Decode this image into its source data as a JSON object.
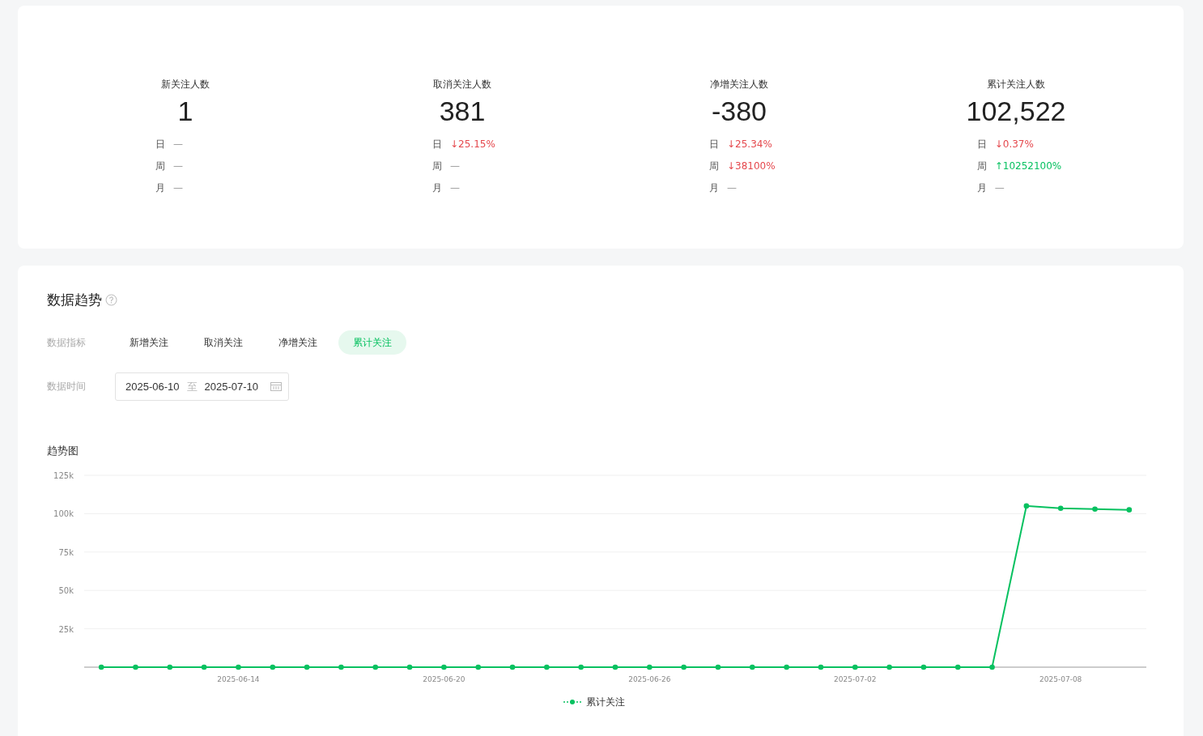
{
  "stats": [
    {
      "label": "新关注人数",
      "value": "1",
      "changes": [
        {
          "period": "日",
          "text": "—",
          "color": "#999999"
        },
        {
          "period": "周",
          "text": "—",
          "color": "#999999"
        },
        {
          "period": "月",
          "text": "—",
          "color": "#999999"
        }
      ]
    },
    {
      "label": "取消关注人数",
      "value": "381",
      "changes": [
        {
          "period": "日",
          "text": "↓25.15%",
          "color": "#e5484d"
        },
        {
          "period": "周",
          "text": "—",
          "color": "#999999"
        },
        {
          "period": "月",
          "text": "—",
          "color": "#999999"
        }
      ]
    },
    {
      "label": "净增关注人数",
      "value": "-380",
      "changes": [
        {
          "period": "日",
          "text": "↓25.34%",
          "color": "#e5484d"
        },
        {
          "period": "周",
          "text": "↓38100%",
          "color": "#e5484d"
        },
        {
          "period": "月",
          "text": "—",
          "color": "#999999"
        }
      ]
    },
    {
      "label": "累计关注人数",
      "value": "102,522",
      "changes": [
        {
          "period": "日",
          "text": "↓0.37%",
          "color": "#e5484d"
        },
        {
          "period": "周",
          "text": "↑10252100%",
          "color": "#07c160"
        },
        {
          "period": "月",
          "text": "—",
          "color": "#999999"
        }
      ]
    }
  ],
  "trend": {
    "title": "数据趋势",
    "metric_label": "数据指标",
    "metrics": [
      {
        "label": "新增关注",
        "selected": false
      },
      {
        "label": "取消关注",
        "selected": false
      },
      {
        "label": "净增关注",
        "selected": false
      },
      {
        "label": "累计关注",
        "selected": true
      }
    ],
    "date_label": "数据时间",
    "date_range": {
      "start": "2025-06-10",
      "separator": "至",
      "end": "2025-07-10"
    },
    "chart_title": "趋势图",
    "chart_data": {
      "type": "line",
      "categories": [
        null,
        null,
        null,
        null,
        "2025-06-14",
        null,
        null,
        null,
        null,
        null,
        "2025-06-20",
        null,
        null,
        null,
        null,
        null,
        "2025-06-26",
        null,
        null,
        null,
        null,
        null,
        "2025-07-02",
        null,
        null,
        null,
        null,
        null,
        "2025-07-08",
        null,
        null
      ],
      "series": [
        {
          "name": "累计关注",
          "color": "#07c160",
          "marker": "circle",
          "values": [
            0,
            0,
            0,
            0,
            0,
            0,
            0,
            0,
            0,
            0,
            0,
            0,
            0,
            0,
            0,
            0,
            0,
            0,
            0,
            0,
            0,
            0,
            0,
            0,
            0,
            0,
            0,
            105000,
            103500,
            103000,
            102500
          ]
        }
      ],
      "grid": true,
      "ylim": [
        0,
        125000
      ],
      "yticks": [
        {
          "value": 25000,
          "label": "25k"
        },
        {
          "value": 50000,
          "label": "50k"
        },
        {
          "value": 75000,
          "label": "75k"
        },
        {
          "value": 100000,
          "label": "100k"
        },
        {
          "value": 125000,
          "label": "125k"
        }
      ]
    }
  }
}
